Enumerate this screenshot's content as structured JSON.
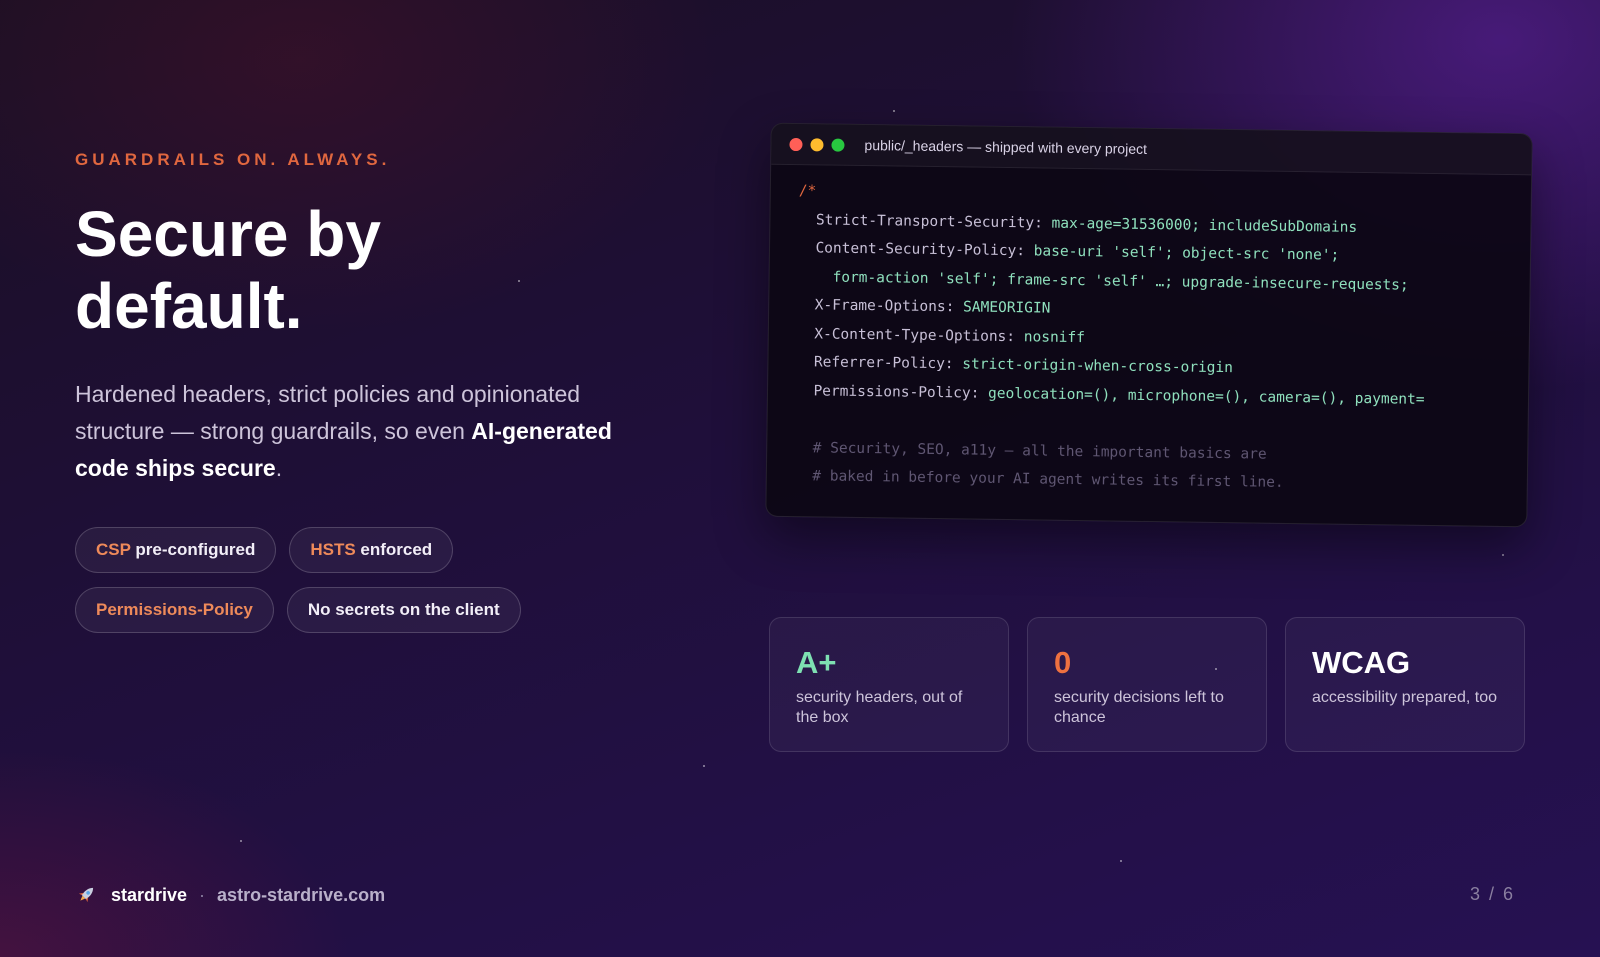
{
  "hero": {
    "eyebrow": "GUARDRAILS ON. ALWAYS.",
    "title_line1": "Secure by",
    "title_line2": "default.",
    "lead_part1": "Hardened headers, strict policies and opinionated structure — strong guardrails, so even ",
    "lead_bold": "AI-generated code ships secure",
    "lead_end": "."
  },
  "pills": [
    {
      "highlight": "CSP",
      "rest": " pre-configured"
    },
    {
      "highlight": "HSTS",
      "rest": " enforced"
    },
    {
      "highlight": "Permissions-Policy",
      "rest": ""
    },
    {
      "highlight": "",
      "rest": "No secrets on the client"
    }
  ],
  "code_window": {
    "title": "public/_headers — shipped with every project",
    "dot_colors": [
      "#ff5f57",
      "#febc2e",
      "#28c840"
    ],
    "lines": [
      {
        "kind": "path",
        "text": "/*"
      },
      {
        "kind": "header",
        "indent": "  ",
        "key": "Strict-Transport-Security:",
        "value": " max-age=31536000; includeSubDomains"
      },
      {
        "kind": "header",
        "indent": "  ",
        "key": "Content-Security-Policy:",
        "value": " base-uri 'self'; object-src 'none';"
      },
      {
        "kind": "header",
        "indent": "    ",
        "key": "",
        "value": "form-action 'self'; frame-src 'self' …; upgrade-insecure-requests;"
      },
      {
        "kind": "header",
        "indent": "  ",
        "key": "X-Frame-Options:",
        "value": " SAMEORIGIN"
      },
      {
        "kind": "header",
        "indent": "  ",
        "key": "X-Content-Type-Options:",
        "value": " nosniff"
      },
      {
        "kind": "header",
        "indent": "  ",
        "key": "Referrer-Policy:",
        "value": " strict-origin-when-cross-origin"
      },
      {
        "kind": "header",
        "indent": "  ",
        "key": "Permissions-Policy:",
        "value": " geolocation=(), microphone=(), camera=(), payment="
      },
      {
        "kind": "blank",
        "text": ""
      },
      {
        "kind": "comment",
        "text": "  # Security, SEO, a11y — all the important basics are"
      },
      {
        "kind": "comment",
        "text": "  # baked in before your AI agent writes its first line."
      }
    ]
  },
  "stats": [
    {
      "big": "A+",
      "desc": "security headers, out of the box",
      "color": "green"
    },
    {
      "big": "0",
      "desc": "security decisions left to chance",
      "color": "orng"
    },
    {
      "big": "WCAG",
      "desc": "accessibility prepared, too",
      "color": "white"
    }
  ],
  "footer": {
    "icon": "rocket-icon",
    "brand": "stardrive",
    "separator": "·",
    "url": "astro-stardrive.com",
    "pager": "3 / 6"
  }
}
